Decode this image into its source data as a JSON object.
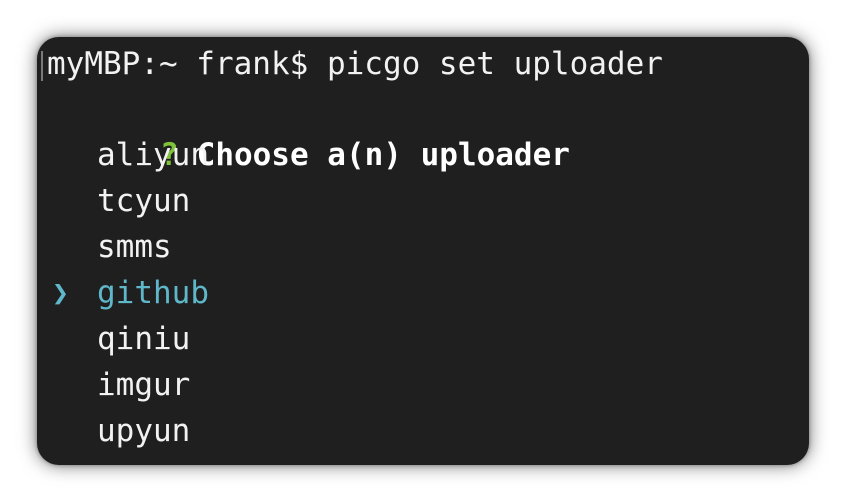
{
  "terminal": {
    "prompt_line": "myMBP:~ frank$ picgo set uploader",
    "question_mark": "?",
    "question": "Choose a(n) uploader",
    "pointer_glyph": "❯",
    "options": [
      "aliyun",
      "tcyun",
      "smms",
      "github",
      "qiniu",
      "imgur",
      "upyun"
    ],
    "selected_option": "github",
    "colors": {
      "background": "#1f1f1f",
      "text": "#f2f2f2",
      "question_mark": "#7fc23a",
      "selected": "#5fb8c9"
    }
  }
}
